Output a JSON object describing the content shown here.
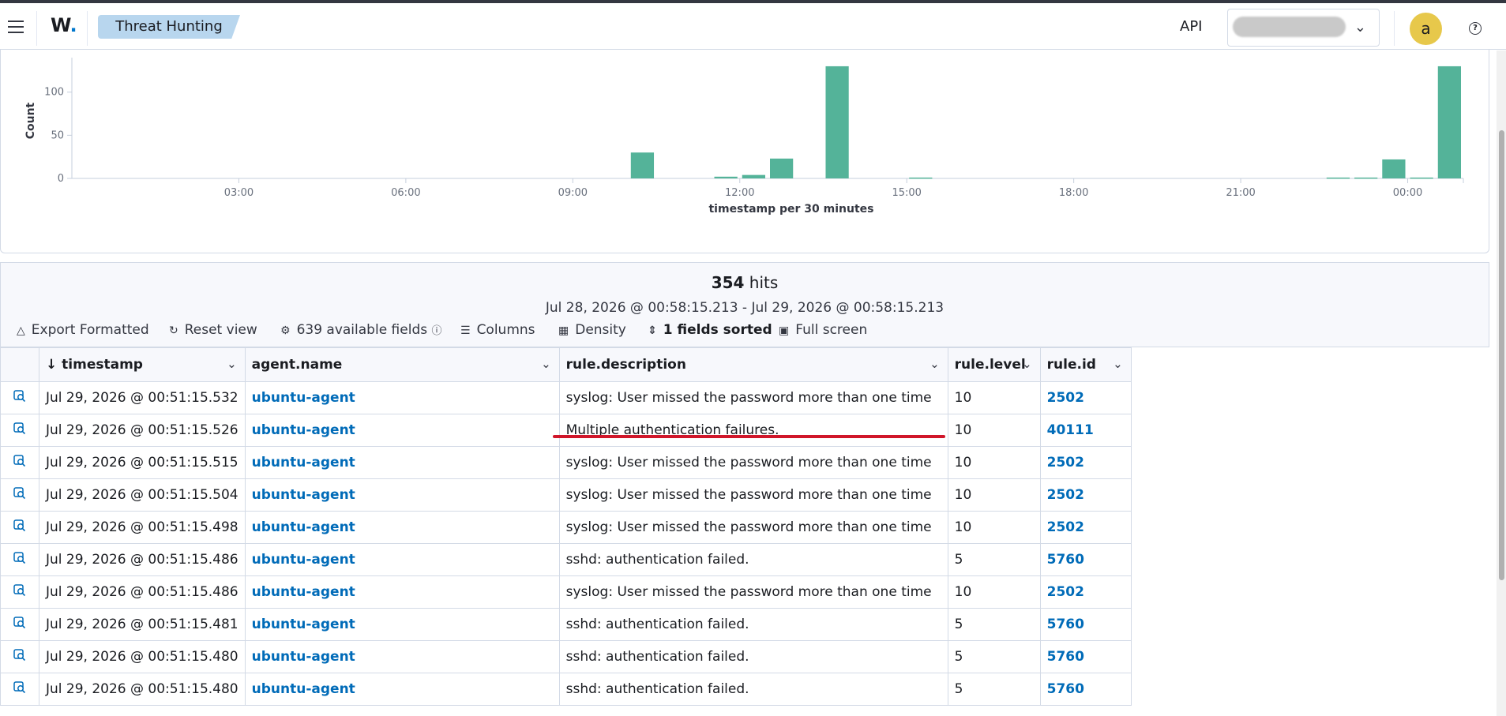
{
  "header": {
    "logo_text": "W",
    "logo_dot": ".",
    "breadcrumb": "Threat Hunting",
    "api_label": "API",
    "avatar_letter": "a",
    "help_glyph": "?"
  },
  "chart_data": {
    "type": "bar",
    "ylabel": "Count",
    "xlabel": "timestamp per 30 minutes",
    "y_ticks": [
      "0",
      "50",
      "100"
    ],
    "ylim": [
      0,
      140
    ],
    "x_ticks": [
      "03:00",
      "06:00",
      "09:00",
      "12:00",
      "15:00",
      "18:00",
      "21:00",
      "00:00"
    ],
    "color": "#54b399",
    "bars": [
      {
        "x": "10:00",
        "value": 30
      },
      {
        "x": "11:30",
        "value": 2
      },
      {
        "x": "12:00",
        "value": 4
      },
      {
        "x": "12:30",
        "value": 23
      },
      {
        "x": "13:30",
        "value": 130
      },
      {
        "x": "15:00",
        "value": 1
      },
      {
        "x": "22:30",
        "value": 1
      },
      {
        "x": "23:00",
        "value": 1
      },
      {
        "x": "23:30",
        "value": 22
      },
      {
        "x": "00:00",
        "value": 1
      },
      {
        "x": "00:30",
        "value": 130
      }
    ]
  },
  "summary": {
    "hits_count": "354",
    "hits_label": "hits",
    "date_range": "Jul 28, 2026 @ 00:58:15.213 - Jul 29, 2026 @ 00:58:15.213"
  },
  "toolbar": {
    "export": "Export Formatted",
    "reset": "Reset view",
    "fields": "639 available fields",
    "columns": "Columns",
    "density": "Density",
    "sorted": "1 fields sorted",
    "fullscreen": "Full screen"
  },
  "table": {
    "columns": [
      "timestamp",
      "agent.name",
      "rule.description",
      "rule.level",
      "rule.id"
    ],
    "rows": [
      [
        "Jul 29, 2026 @ 00:51:15.532",
        "ubuntu-agent",
        "syslog: User missed the password more than one time",
        "10",
        "2502"
      ],
      [
        "Jul 29, 2026 @ 00:51:15.526",
        "ubuntu-agent",
        "Multiple authentication failures.",
        "10",
        "40111"
      ],
      [
        "Jul 29, 2026 @ 00:51:15.515",
        "ubuntu-agent",
        "syslog: User missed the password more than one time",
        "10",
        "2502"
      ],
      [
        "Jul 29, 2026 @ 00:51:15.504",
        "ubuntu-agent",
        "syslog: User missed the password more than one time",
        "10",
        "2502"
      ],
      [
        "Jul 29, 2026 @ 00:51:15.498",
        "ubuntu-agent",
        "syslog: User missed the password more than one time",
        "10",
        "2502"
      ],
      [
        "Jul 29, 2026 @ 00:51:15.486",
        "ubuntu-agent",
        "sshd: authentication failed.",
        "5",
        "5760"
      ],
      [
        "Jul 29, 2026 @ 00:51:15.486",
        "ubuntu-agent",
        "syslog: User missed the password more than one time",
        "10",
        "2502"
      ],
      [
        "Jul 29, 2026 @ 00:51:15.481",
        "ubuntu-agent",
        "sshd: authentication failed.",
        "5",
        "5760"
      ],
      [
        "Jul 29, 2026 @ 00:51:15.480",
        "ubuntu-agent",
        "sshd: authentication failed.",
        "5",
        "5760"
      ],
      [
        "Jul 29, 2026 @ 00:51:15.480",
        "ubuntu-agent",
        "sshd: authentication failed.",
        "5",
        "5760"
      ]
    ]
  }
}
